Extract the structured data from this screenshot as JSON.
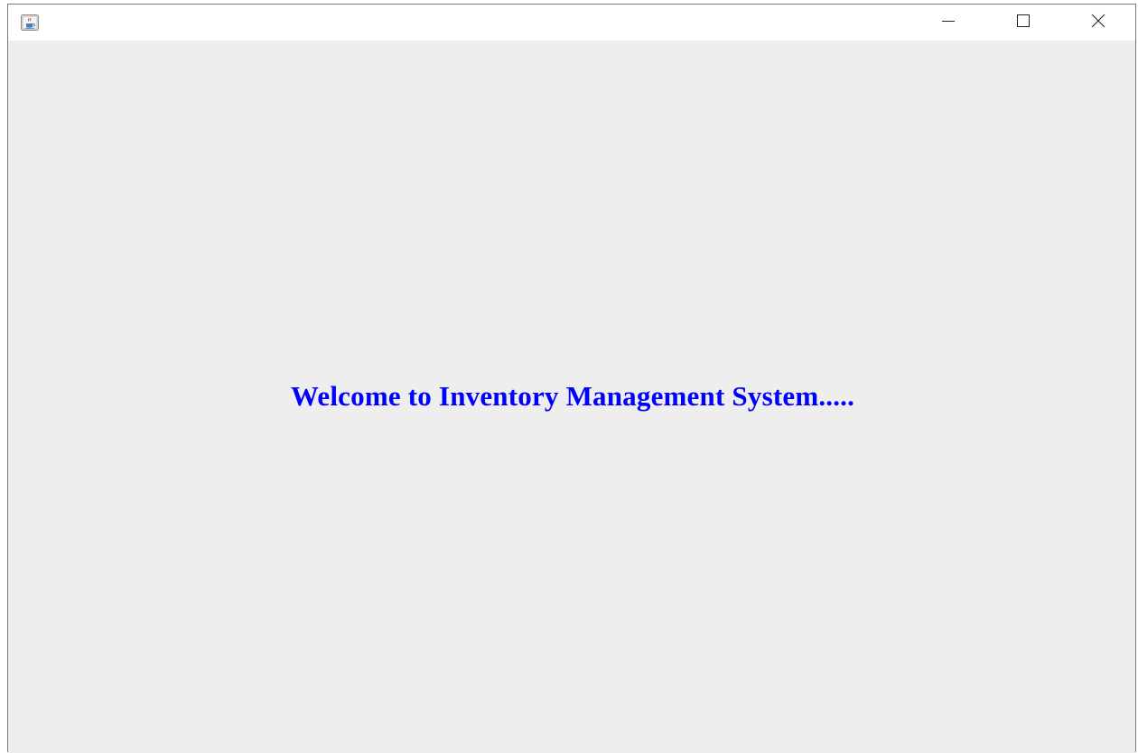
{
  "window": {
    "title": "",
    "icon": "java-coffee-cup-icon",
    "controls": {
      "minimize_icon": "minimize-icon",
      "maximize_icon": "maximize-icon",
      "close_icon": "close-icon"
    }
  },
  "content": {
    "welcome_text": "Welcome to Inventory Management System.....",
    "welcome_color": "#0000ff",
    "background_color": "#eeeeee"
  }
}
